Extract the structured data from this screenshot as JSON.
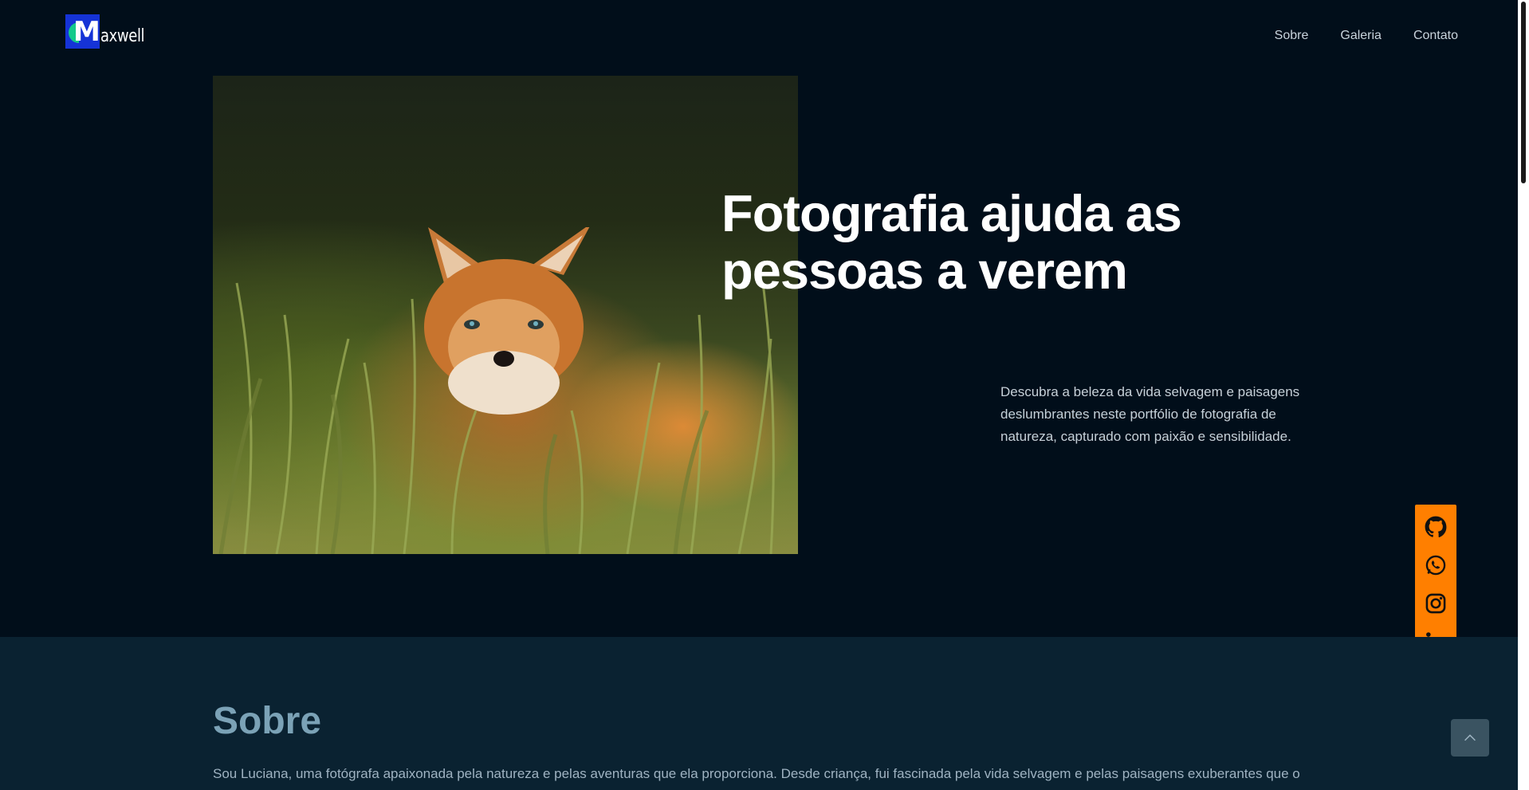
{
  "header": {
    "logo": {
      "mark_letter": "M",
      "text": "axwell"
    },
    "nav": [
      {
        "label": "Sobre"
      },
      {
        "label": "Galeria"
      },
      {
        "label": "Contato"
      }
    ]
  },
  "hero": {
    "title_line1": "Fotografia ajuda as",
    "title_line2": "pessoas a verem",
    "description": "Descubra a beleza da vida selvagem e paisagens deslumbrantes neste portfólio de fotografia de natureza, capturado com paixão e sensibilidade.",
    "image_icon": "fox-in-grass-photo"
  },
  "social": {
    "color": "#ff7f00",
    "items": [
      {
        "icon": "github-icon"
      },
      {
        "icon": "whatsapp-icon"
      },
      {
        "icon": "instagram-icon"
      },
      {
        "icon": "linkedin-icon"
      }
    ]
  },
  "about": {
    "title": "Sobre",
    "text": "Sou Luciana, uma fotógrafa apaixonada pela natureza e pelas aventuras que ela proporciona. Desde criança, fui fascinada pela vida selvagem e pelas paisagens exuberantes que o"
  },
  "back_to_top": {
    "icon": "chevron-up-icon"
  }
}
